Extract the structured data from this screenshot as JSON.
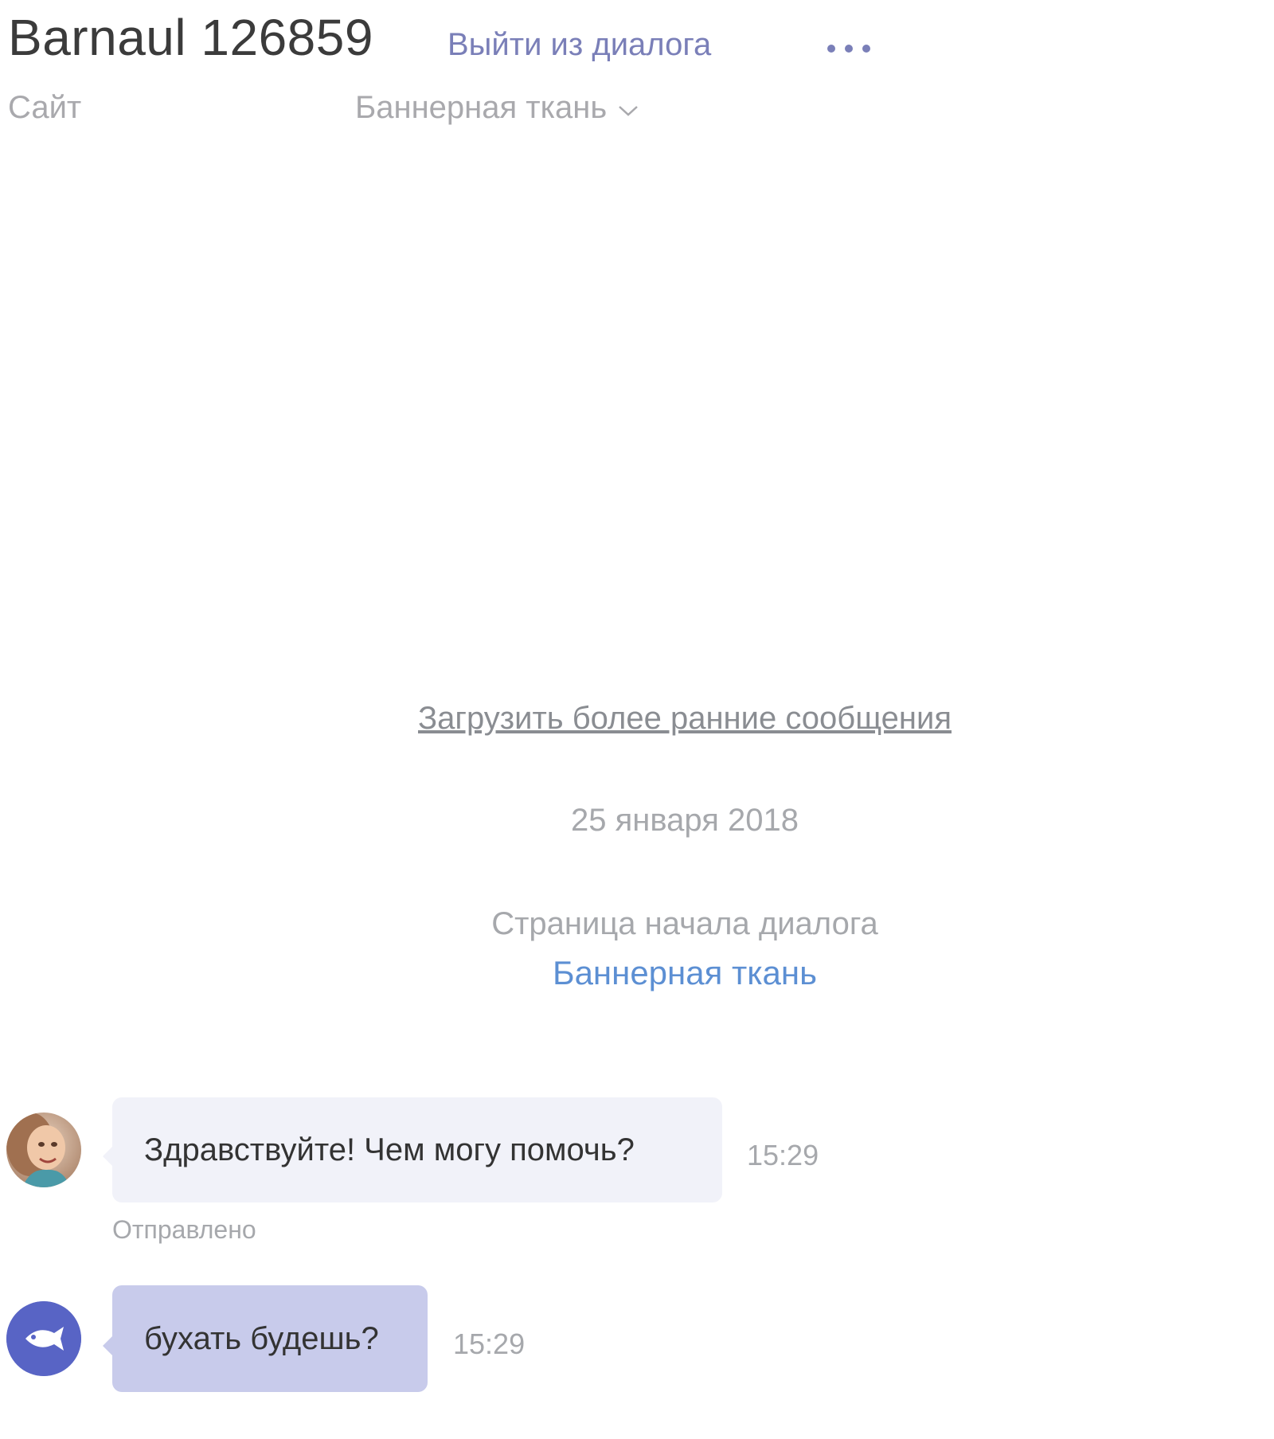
{
  "header": {
    "title": "Barnaul 126859",
    "exit_label": "Выйти из диалога",
    "more_icon": "more-horizontal-icon",
    "site_label": "Сайт",
    "page_select_label": "Баннерная ткань",
    "page_select_icon": "chevron-down-icon"
  },
  "chat": {
    "load_earlier": "Загрузить более ранние сообщения",
    "date_separator": "25 января 2018",
    "start_page_label": "Страница начала диалога",
    "start_page_link": "Баннерная ткань",
    "messages": [
      {
        "sender": "operator",
        "avatar": "operator-photo-avatar",
        "text": "Здравствуйте! Чем могу помочь?",
        "time": "15:29",
        "status": "Отправлено"
      },
      {
        "sender": "visitor",
        "avatar": "fish-icon",
        "text": "бухать будешь?",
        "time": "15:29"
      }
    ]
  },
  "colors": {
    "accent": "#7a7fb8",
    "link": "#5c8fd3",
    "operator_bubble": "#f1f2f9",
    "visitor_bubble": "#c8cbeb",
    "visitor_avatar": "#5864c5"
  }
}
